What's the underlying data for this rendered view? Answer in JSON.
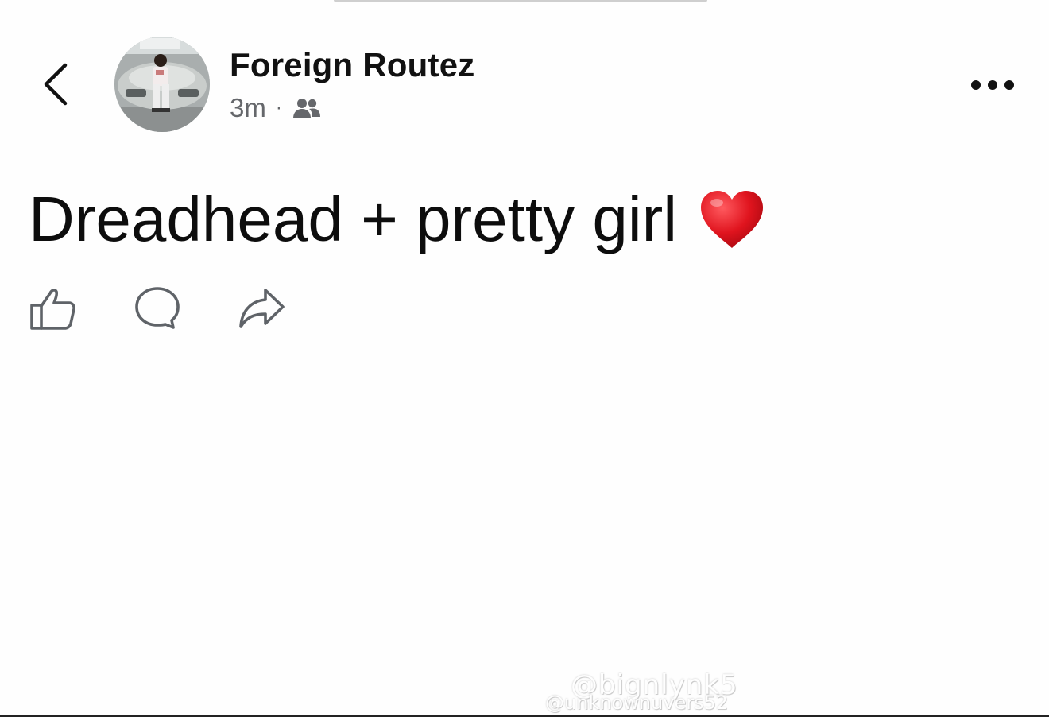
{
  "header": {
    "author_name": "Foreign Routez",
    "timestamp": "3m",
    "separator": "·",
    "audience_icon": "friends-icon",
    "back_icon": "chevron-left-icon",
    "more_icon": "more-horizontal-icon"
  },
  "post": {
    "text": "Dreadhead + pretty girl",
    "emoji_icon": "red-heart-icon"
  },
  "actions": [
    {
      "icon": "like-icon"
    },
    {
      "icon": "comment-icon"
    },
    {
      "icon": "share-icon"
    }
  ],
  "watermark": {
    "handle_top": "@bignlynk5",
    "handle_bottom": "@unknownuvers52"
  },
  "colors": {
    "text_primary": "#111111",
    "text_secondary": "#65676b",
    "icon_gray": "#5f6368",
    "heart_red": "#e0141e"
  }
}
